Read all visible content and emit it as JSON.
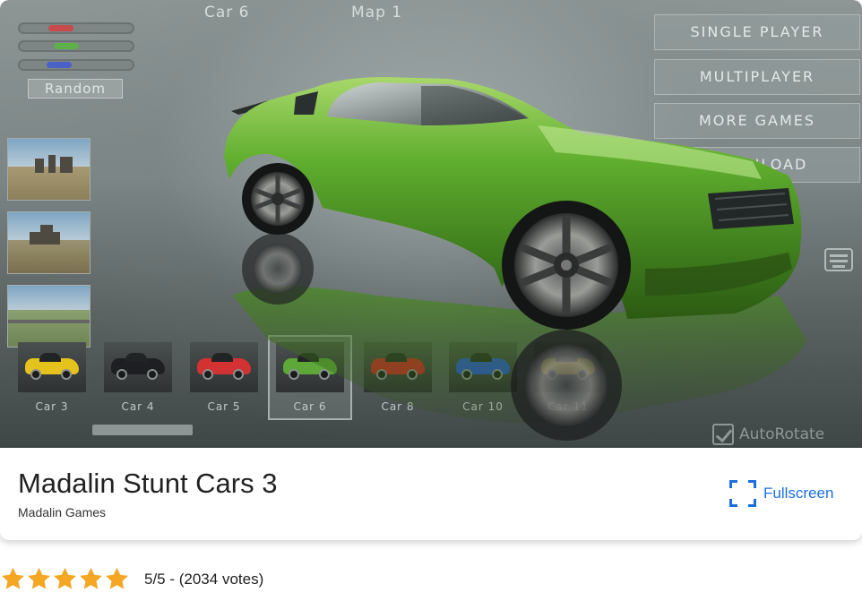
{
  "game_ui": {
    "selected_car_label": "Car 6",
    "selected_map_label": "Map 1",
    "random_label": "Random",
    "color_sliders": [
      {
        "name": "red",
        "color": "#c84a4a"
      },
      {
        "name": "green",
        "color": "#5db04a"
      },
      {
        "name": "blue",
        "color": "#4a62c8"
      }
    ],
    "menu": [
      "SINGLE PLAYER",
      "MULTIPLAYER",
      "MORE GAMES",
      "DOWNLOAD"
    ],
    "cars": [
      {
        "label": "Car 3",
        "color": "#e6c21c"
      },
      {
        "label": "Car 4",
        "color": "#1e1f22"
      },
      {
        "label": "Car 5",
        "color": "#d33232"
      },
      {
        "label": "Car 6",
        "color": "#5ea83a"
      },
      {
        "label": "Car 8",
        "color": "#d02424"
      },
      {
        "label": "Car 10",
        "color": "#2856d6"
      },
      {
        "label": "Car 11",
        "color": "#e0c020"
      }
    ],
    "selected_car_index": 3,
    "autorotate_label": "AutoRotate",
    "autorotate_checked": true,
    "car_main_color": "#5fae2e"
  },
  "info": {
    "title": "Madalin Stunt Cars 3",
    "developer": "Madalin Games",
    "fullscreen_label": "Fullscreen",
    "accent_color": "#1a6fe0"
  },
  "rating": {
    "stars": 5,
    "star_color": "#f5a623",
    "text": "5/5 - (2034 votes)"
  }
}
